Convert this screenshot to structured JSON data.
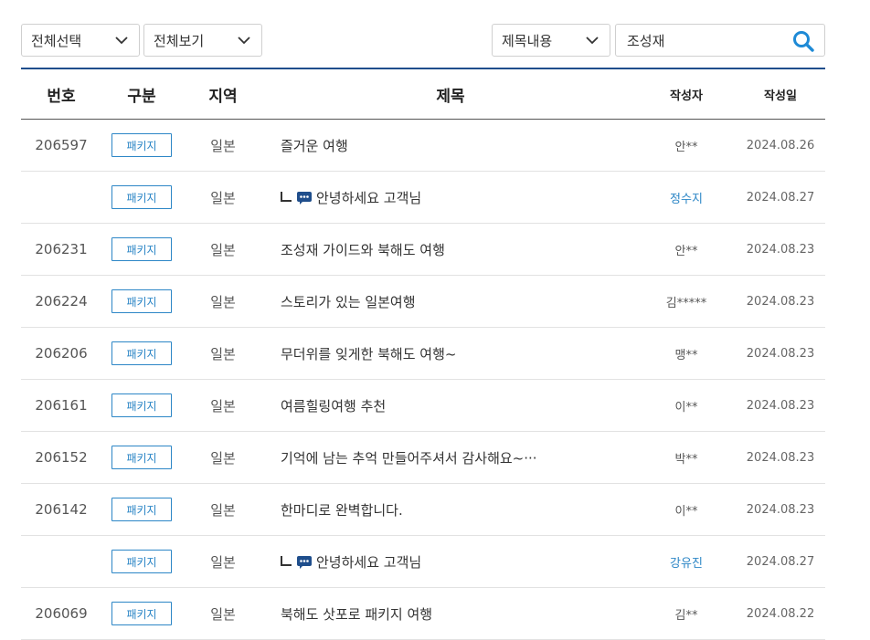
{
  "filters": {
    "select_all": "전체선택",
    "view_all": "전체보기",
    "search_type": "제목내용",
    "search_value": "조성재",
    "search_icon": "search-icon"
  },
  "colors": {
    "accent": "#1f4e8c",
    "badge": "#2c86c6",
    "search_icon": "#1e8ad6"
  },
  "columns": [
    "번호",
    "구분",
    "지역",
    "제목",
    "작성자",
    "작성일"
  ],
  "rows": [
    {
      "num": "206597",
      "category": "패키지",
      "region": "일본",
      "title": "즐거운 여행",
      "reply": false,
      "author": "안**",
      "staff": false,
      "date": "2024.08.26"
    },
    {
      "num": "",
      "category": "패키지",
      "region": "일본",
      "title": "안녕하세요 고객님",
      "reply": true,
      "author": "정수지",
      "staff": true,
      "date": "2024.08.27"
    },
    {
      "num": "206231",
      "category": "패키지",
      "region": "일본",
      "title": "조성재 가이드와 북해도 여행",
      "reply": false,
      "author": "안**",
      "staff": false,
      "date": "2024.08.23"
    },
    {
      "num": "206224",
      "category": "패키지",
      "region": "일본",
      "title": "스토리가 있는 일본여행",
      "reply": false,
      "author": "김*****",
      "staff": false,
      "date": "2024.08.23"
    },
    {
      "num": "206206",
      "category": "패키지",
      "region": "일본",
      "title": "무더위를 잊게한 북해도 여행~",
      "reply": false,
      "author": "맹**",
      "staff": false,
      "date": "2024.08.23"
    },
    {
      "num": "206161",
      "category": "패키지",
      "region": "일본",
      "title": "여름힐링여행 추천",
      "reply": false,
      "author": "이**",
      "staff": false,
      "date": "2024.08.23"
    },
    {
      "num": "206152",
      "category": "패키지",
      "region": "일본",
      "title": "기억에 남는 추억 만들어주셔서 감사해요~···",
      "reply": false,
      "author": "박**",
      "staff": false,
      "date": "2024.08.23"
    },
    {
      "num": "206142",
      "category": "패키지",
      "region": "일본",
      "title": "한마디로 완벽합니다.",
      "reply": false,
      "author": "이**",
      "staff": false,
      "date": "2024.08.23"
    },
    {
      "num": "",
      "category": "패키지",
      "region": "일본",
      "title": "안녕하세요 고객님",
      "reply": true,
      "author": "강유진",
      "staff": true,
      "date": "2024.08.27"
    },
    {
      "num": "206069",
      "category": "패키지",
      "region": "일본",
      "title": "북해도 삿포로 패키지 여행",
      "reply": false,
      "author": "김**",
      "staff": false,
      "date": "2024.08.22"
    }
  ]
}
